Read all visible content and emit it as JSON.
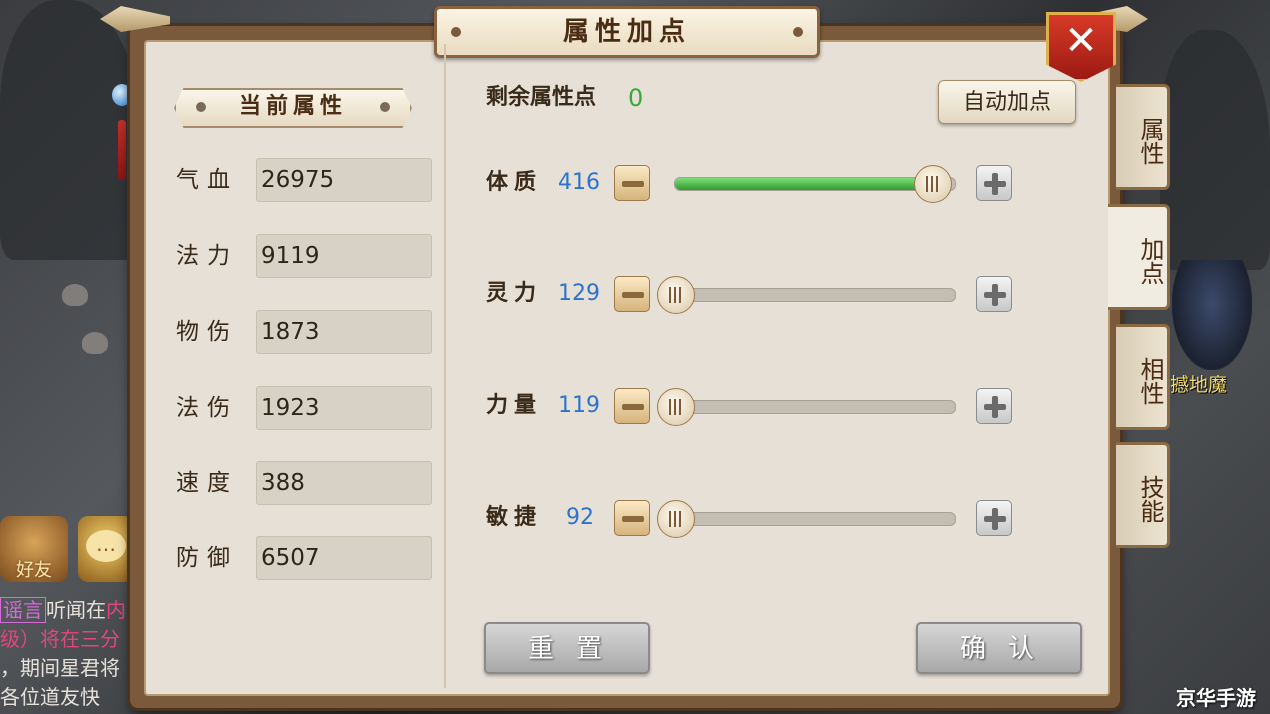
{
  "window": {
    "title": "属性加点",
    "close_icon": "close-icon"
  },
  "current_attributes": {
    "heading": "当前属性",
    "stats": [
      {
        "label": "气血",
        "value": "26975"
      },
      {
        "label": "法力",
        "value": "9119"
      },
      {
        "label": "物伤",
        "value": "1873"
      },
      {
        "label": "法伤",
        "value": "1923"
      },
      {
        "label": "速度",
        "value": "388"
      },
      {
        "label": "防御",
        "value": "6507"
      }
    ]
  },
  "points": {
    "remaining_label": "剩余属性点",
    "remaining_value": "0",
    "auto_button": "自动加点",
    "attributes": [
      {
        "label": "体质",
        "value": "416",
        "slider_fraction": 0.98,
        "filled": true
      },
      {
        "label": "灵力",
        "value": "129",
        "slider_fraction": 0.0,
        "filled": false
      },
      {
        "label": "力量",
        "value": "119",
        "slider_fraction": 0.0,
        "filled": false
      },
      {
        "label": "敏捷",
        "value": "92",
        "slider_fraction": 0.0,
        "filled": false
      }
    ],
    "reset_button": "重置",
    "confirm_button": "确认"
  },
  "side_tabs": [
    {
      "label": "属性",
      "active": false
    },
    {
      "label": "加点",
      "active": true
    },
    {
      "label": "相性",
      "active": false
    },
    {
      "label": "技能",
      "active": false
    }
  ],
  "background": {
    "friend_button": "好友",
    "chat_lines": [
      {
        "tag": "谣言",
        "text": "听闻在",
        "tail": "内"
      },
      {
        "text": "级）将在",
        "tail": "三分"
      },
      {
        "text": "，期间星君将"
      },
      {
        "text": "各位道友快"
      }
    ],
    "monster_name": "撼地魔",
    "watermark": "京华手游"
  },
  "colors": {
    "accent_green": "#3aa83a",
    "value_blue": "#2a74cf",
    "close_red": "#c8281c"
  }
}
